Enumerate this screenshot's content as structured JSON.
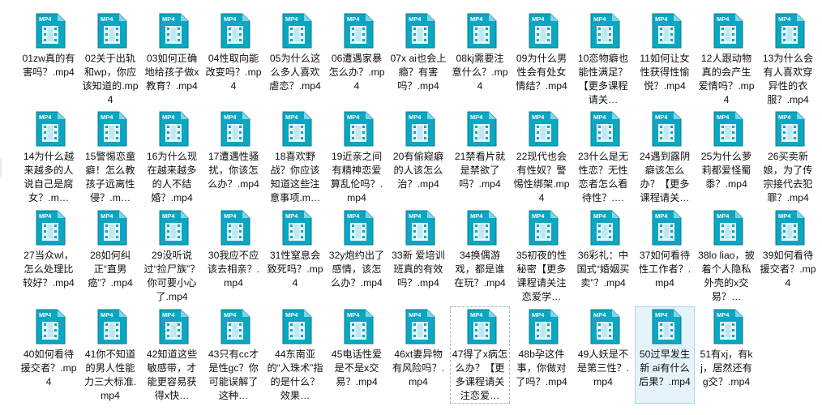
{
  "file_type_badge": "MP4",
  "icon": "video-file-icon",
  "colors": {
    "icon_teal": "#0aa6c2",
    "icon_dark": "#06768d",
    "selection_bg": "#e5f3fb",
    "selection_border": "#a9d6f5"
  },
  "files": [
    {
      "name": "01zw真的有害吗？.mp4"
    },
    {
      "name": "02关于出轨和wp，你应该知道的.mp4"
    },
    {
      "name": "03如何正确地给孩子做x教育？.mp4"
    },
    {
      "name": "04性取向能改变吗？.mp4"
    },
    {
      "name": "05为什么这么多人喜欢虐恋？.mp4"
    },
    {
      "name": "06遭遇家暴怎么办？.mp4"
    },
    {
      "name": "07x ai也会上瘾？有害吗？.mp4"
    },
    {
      "name": "08kj需要注意什么？.mp4"
    },
    {
      "name": "09为什么男性会有处女情结？.mp4"
    },
    {
      "name": "10恋物癖也能性满足？【更多课程请关…"
    },
    {
      "name": "11如何让女性获得性愉悦？.mp4"
    },
    {
      "name": "12人跟动物真的会产生爱情吗？.mp4"
    },
    {
      "name": "13为什么会有人喜欢穿异性的衣服？.mp4"
    },
    {
      "name": "14为什么越来越多的人说自己是腐女？.m…"
    },
    {
      "name": "15警惕恋童癖！怎么教孩子远离性侵？.m…"
    },
    {
      "name": "16为什么现在越来越多的人不结婚？.mp4"
    },
    {
      "name": "17遭遇性骚扰，你该怎么办？.mp4"
    },
    {
      "name": "18喜欢野战？你应该知道这些注意事项.m…"
    },
    {
      "name": "19近亲之间有精神恋爱算乱伦吗？.mp4"
    },
    {
      "name": "20有偷窥癖的人该怎么治？.mp4"
    },
    {
      "name": "21禁看片就是禁欲了吗？.mp4"
    },
    {
      "name": "22现代也会有性奴？警惕性绑架.mp4"
    },
    {
      "name": "23什么是无性恋？无性恋者怎么看待性？.…"
    },
    {
      "name": "24遇到露阴癖该怎么办？【更多课程请关…"
    },
    {
      "name": "25为什么萝莉都爱怪蜀黍？.mp4"
    },
    {
      "name": "26买卖新娘，为了传宗接代去犯罪？.mp4"
    },
    {
      "name": "27当众wl，怎么处理比较好？.mp4"
    },
    {
      "name": "28如何纠正“直男癌”？.mp4"
    },
    {
      "name": "29没听说过“捡尸族”？你可要小心了.mp4"
    },
    {
      "name": "30我应不应该去相亲？.mp4"
    },
    {
      "name": "31性窒息会致死吗？.mp4"
    },
    {
      "name": "32y炮约出了感情，该怎么办？.mp4"
    },
    {
      "name": "33新 爱培训班真的有效吗？.mp4"
    },
    {
      "name": "34换偶游戏，都是谁在玩？.mp4"
    },
    {
      "name": "35初夜的性秘密【更多课程请关注恋爱学…"
    },
    {
      "name": "36彩礼：中国式“婚姻买卖”？.mp4"
    },
    {
      "name": "37如何看待性工作者？.mp4"
    },
    {
      "name": "38lo liao，披着个人隐私外壳的x交易？…"
    },
    {
      "name": "39如何看待援交者？.mp4"
    },
    {
      "name": "40如何看待援交者？.mp4"
    },
    {
      "name": "41你不知道的男人性能力三大标准.mp4"
    },
    {
      "name": "42知道这些敏感带，才能更容易获得x快…"
    },
    {
      "name": "43只有cc才是性gc？你可能误解了这种…"
    },
    {
      "name": "44东南亚的“入珠术”指的是什么？效果…"
    },
    {
      "name": "45电话性爱是不是x交易？.mp4"
    },
    {
      "name": "46xt妻异物有风险吗？.mp4"
    },
    {
      "name": "47得了x病怎么办？【更多课程请关注恋爱…"
    },
    {
      "name": "48b孕这件事，你做对了吗？.mp4"
    },
    {
      "name": "49人妖是不是第三性？.mp4"
    },
    {
      "name": "50过早发生新 ai有什么后果？.mp4"
    },
    {
      "name": "51有xj，有kj，居然还有g交？.mp4"
    }
  ]
}
